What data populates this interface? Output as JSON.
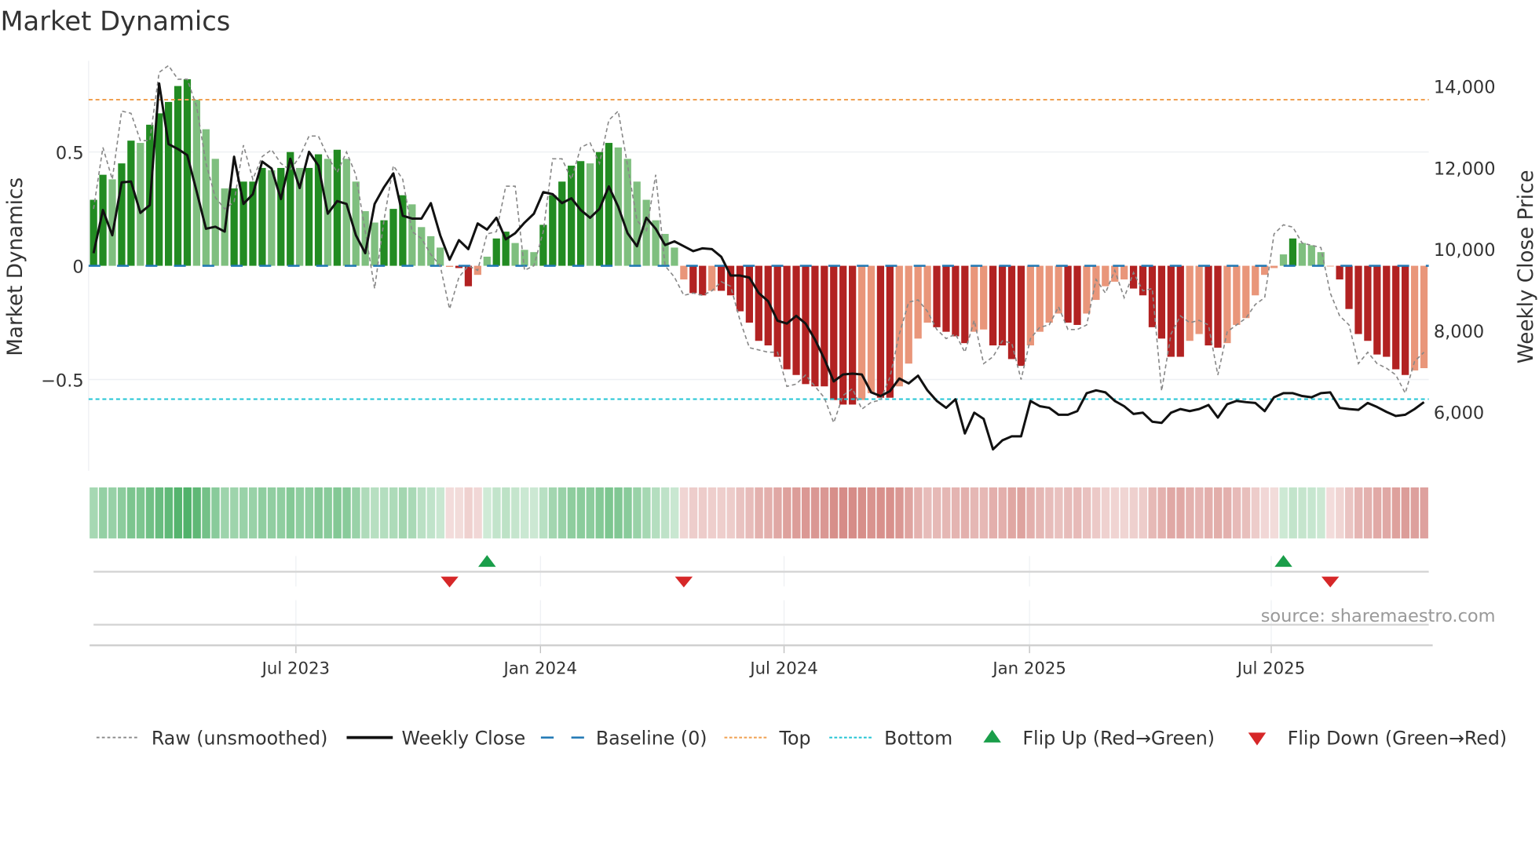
{
  "chart_data": {
    "type": "bar",
    "title": "Market Dynamics",
    "ylabel": "Market Dynamics",
    "y2label": "Weekly Close Price",
    "ylim": [
      -0.9,
      0.9
    ],
    "y2lim": [
      4700,
      14600
    ],
    "yticks": [
      {
        "v": 0.5,
        "label": "0.5"
      },
      {
        "v": 0,
        "label": "0"
      },
      {
        "v": -0.5,
        "label": "−0.5"
      }
    ],
    "y2ticks": [
      {
        "v": 14000,
        "label": "14,000"
      },
      {
        "v": 12000,
        "label": "12,000"
      },
      {
        "v": 10000,
        "label": "10,000"
      },
      {
        "v": 8000,
        "label": "8,000"
      },
      {
        "v": 6000,
        "label": "6,000"
      }
    ],
    "x_unit": "week index",
    "xticks": [
      {
        "week": 21.6,
        "label": "Jul 2023"
      },
      {
        "week": 47.7,
        "label": "Jan 2024"
      },
      {
        "week": 73.7,
        "label": "Jul 2024"
      },
      {
        "week": 99.9,
        "label": "Jan 2025"
      },
      {
        "week": 125.7,
        "label": "Jul 2025"
      }
    ],
    "top_level": 0.73,
    "bottom_level": -0.586,
    "baseline": 0,
    "smoothed": [
      0.29,
      0.4,
      0.38,
      0.45,
      0.55,
      0.54,
      0.62,
      0.67,
      0.72,
      0.79,
      0.82,
      0.73,
      0.6,
      0.47,
      0.34,
      0.34,
      0.37,
      0.37,
      0.43,
      0.42,
      0.43,
      0.5,
      0.43,
      0.43,
      0.49,
      0.47,
      0.51,
      0.47,
      0.37,
      0.24,
      0.19,
      0.2,
      0.25,
      0.31,
      0.27,
      0.17,
      0.13,
      0.08,
      -0.005,
      -0.01,
      -0.09,
      -0.04,
      0.04,
      0.12,
      0.15,
      0.1,
      0.07,
      0.06,
      0.18,
      0.31,
      0.37,
      0.44,
      0.46,
      0.45,
      0.5,
      0.54,
      0.52,
      0.47,
      0.37,
      0.29,
      0.2,
      0.14,
      0.08,
      -0.06,
      -0.12,
      -0.13,
      -0.11,
      -0.11,
      -0.13,
      -0.2,
      -0.25,
      -0.33,
      -0.35,
      -0.4,
      -0.455,
      -0.48,
      -0.52,
      -0.53,
      -0.53,
      -0.59,
      -0.61,
      -0.61,
      -0.59,
      -0.56,
      -0.58,
      -0.58,
      -0.53,
      -0.43,
      -0.32,
      -0.25,
      -0.27,
      -0.29,
      -0.31,
      -0.34,
      -0.29,
      -0.28,
      -0.35,
      -0.35,
      -0.41,
      -0.44,
      -0.35,
      -0.29,
      -0.25,
      -0.21,
      -0.25,
      -0.26,
      -0.21,
      -0.15,
      -0.09,
      -0.07,
      -0.06,
      -0.1,
      -0.13,
      -0.27,
      -0.32,
      -0.4,
      -0.4,
      -0.33,
      -0.3,
      -0.35,
      -0.36,
      -0.34,
      -0.26,
      -0.23,
      -0.13,
      -0.04,
      -0.01,
      0.05,
      0.12,
      0.1,
      0.09,
      0.06,
      -0.003,
      -0.06,
      -0.19,
      -0.3,
      -0.33,
      -0.39,
      -0.4,
      -0.455,
      -0.48,
      -0.46,
      -0.45
    ],
    "raw": [
      0.25,
      0.52,
      0.38,
      0.68,
      0.67,
      0.55,
      0.55,
      0.85,
      0.88,
      0.82,
      0.82,
      0.7,
      0.45,
      0.3,
      0.25,
      0.28,
      0.53,
      0.38,
      0.48,
      0.51,
      0.45,
      0.42,
      0.48,
      0.57,
      0.57,
      0.48,
      0.41,
      0.5,
      0.4,
      0.15,
      -0.1,
      0.2,
      0.44,
      0.38,
      0.15,
      0.12,
      0.05,
      0.0,
      -0.19,
      -0.05,
      0.0,
      -0.02,
      0.14,
      0.15,
      0.35,
      0.35,
      -0.02,
      0.0,
      0.15,
      0.47,
      0.47,
      0.38,
      0.52,
      0.54,
      0.45,
      0.64,
      0.68,
      0.44,
      0.2,
      0.15,
      0.4,
      0.0,
      -0.05,
      -0.13,
      -0.12,
      -0.13,
      -0.11,
      -0.07,
      -0.09,
      -0.24,
      -0.36,
      -0.37,
      -0.38,
      -0.38,
      -0.53,
      -0.52,
      -0.48,
      -0.53,
      -0.58,
      -0.69,
      -0.57,
      -0.54,
      -0.63,
      -0.6,
      -0.59,
      -0.49,
      -0.3,
      -0.16,
      -0.15,
      -0.2,
      -0.28,
      -0.32,
      -0.3,
      -0.38,
      -0.24,
      -0.43,
      -0.4,
      -0.33,
      -0.34,
      -0.5,
      -0.32,
      -0.27,
      -0.26,
      -0.18,
      -0.28,
      -0.28,
      -0.26,
      -0.06,
      -0.12,
      -0.02,
      -0.14,
      -0.03,
      -0.11,
      -0.1,
      -0.55,
      -0.3,
      -0.22,
      -0.25,
      -0.24,
      -0.26,
      -0.48,
      -0.29,
      -0.26,
      -0.23,
      -0.17,
      -0.14,
      0.14,
      0.18,
      0.17,
      0.1,
      0.09,
      0.08,
      -0.12,
      -0.22,
      -0.26,
      -0.43,
      -0.38,
      -0.43,
      -0.45,
      -0.48,
      -0.56,
      -0.42,
      -0.38
    ],
    "close": [
      9900,
      10960,
      10340,
      11640,
      11660,
      10890,
      11080,
      14070,
      12580,
      12460,
      12310,
      11420,
      10500,
      10550,
      10430,
      12270,
      11110,
      11350,
      12150,
      11980,
      11230,
      12220,
      11500,
      12390,
      12050,
      10870,
      11180,
      11110,
      10340,
      9900,
      11110,
      11520,
      11860,
      10820,
      10750,
      10750,
      11130,
      10340,
      9740,
      10220,
      10000,
      10630,
      10480,
      10770,
      10240,
      10390,
      10650,
      10870,
      11400,
      11350,
      11130,
      11250,
      10960,
      10770,
      10990,
      11540,
      11040,
      10390,
      10070,
      10770,
      10500,
      10100,
      10190,
      10070,
      9950,
      10020,
      10000,
      9810,
      9350,
      9350,
      9300,
      8920,
      8720,
      8240,
      8170,
      8360,
      8170,
      7780,
      7300,
      6750,
      6920,
      6940,
      6920,
      6480,
      6390,
      6510,
      6820,
      6700,
      6890,
      6530,
      6270,
      6100,
      6310,
      5470,
      5980,
      5830,
      5080,
      5300,
      5400,
      5400,
      6270,
      6140,
      6100,
      5930,
      5930,
      6020,
      6460,
      6530,
      6480,
      6270,
      6140,
      5950,
      5980,
      5760,
      5730,
      5980,
      6070,
      6020,
      6070,
      6170,
      5860,
      6190,
      6270,
      6240,
      6220,
      6020,
      6360,
      6460,
      6460,
      6390,
      6360,
      6460,
      6480,
      6100,
      6070,
      6050,
      6220,
      6120,
      6000,
      5900,
      5930,
      6070,
      6240
    ],
    "flip_up_weeks": [
      42,
      127
    ],
    "flip_down_weeks": [
      38,
      63,
      132
    ],
    "legend": [
      {
        "label": "Raw (unsmoothed)",
        "kind": "raw"
      },
      {
        "label": "Weekly Close",
        "kind": "close"
      },
      {
        "label": "Baseline (0)",
        "kind": "baseline"
      },
      {
        "label": "Top",
        "kind": "top"
      },
      {
        "label": "Bottom",
        "kind": "bottom"
      },
      {
        "label": "Flip Up (Red→Green)",
        "kind": "up"
      },
      {
        "label": "Flip Down (Green→Red)",
        "kind": "down"
      }
    ],
    "legend_position": "bottom",
    "annotation": "source: sharemaestro.com",
    "colors": {
      "green_dark": "#228b22",
      "green_light": "#7fbf7f",
      "red_dark": "#b22222",
      "red_light": "#e9967a",
      "top": "#f0a050",
      "bottom": "#22c4d4",
      "baseline": "#1f77b4",
      "close": "#111111",
      "raw": "#888888",
      "heat_green": "#41ab5d",
      "heat_red": "#c8645e",
      "flip_up": "#1a9e4a",
      "flip_down": "#d62728"
    }
  }
}
